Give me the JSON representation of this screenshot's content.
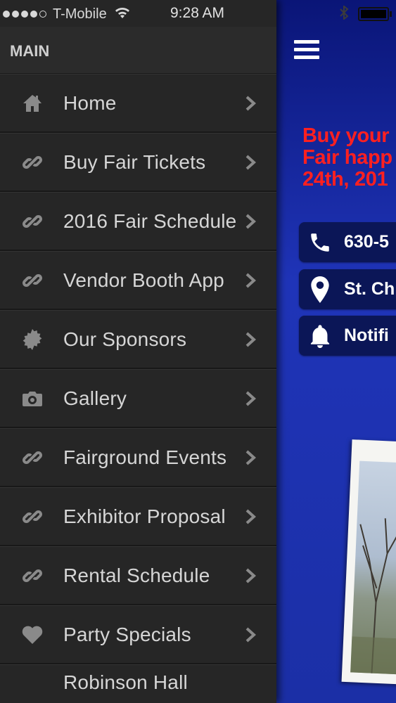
{
  "status_bar": {
    "carrier": "T-Mobile",
    "time": "9:28 AM",
    "signal_icons": [
      "signal-dot",
      "signal-dot",
      "signal-dot",
      "signal-dot",
      "signal-dot-empty"
    ],
    "wifi_icon": "wifi-icon",
    "bluetooth_icon": "bluetooth-icon",
    "battery_icon": "battery-icon"
  },
  "drawer": {
    "section_title": "MAIN",
    "items": [
      {
        "label": "Home",
        "icon": "home-icon"
      },
      {
        "label": "Buy Fair Tickets",
        "icon": "link-icon"
      },
      {
        "label": "2016 Fair Schedule",
        "icon": "link-icon"
      },
      {
        "label": "Vendor Booth App",
        "icon": "link-icon"
      },
      {
        "label": "Our Sponsors",
        "icon": "badge-icon"
      },
      {
        "label": "Gallery",
        "icon": "camera-icon"
      },
      {
        "label": "Fairground Events",
        "icon": "link-icon"
      },
      {
        "label": "Exhibitor Proposal",
        "icon": "link-icon"
      },
      {
        "label": "Rental Schedule",
        "icon": "link-icon"
      },
      {
        "label": "Party Specials",
        "icon": "heart-icon"
      },
      {
        "label": "Robinson Hall",
        "icon": "link-icon"
      }
    ]
  },
  "content": {
    "promo_text": "Buy your\nFair happ\n24th, 201",
    "buttons": [
      {
        "label": "630-5",
        "icon": "phone-icon"
      },
      {
        "label": "St. Ch",
        "icon": "location-pin-icon"
      },
      {
        "label": "Notifi",
        "icon": "bell-icon"
      }
    ]
  },
  "colors": {
    "drawer_bg": "#262626",
    "content_bg": "#1f34b8",
    "promo_red": "#ff2020"
  }
}
